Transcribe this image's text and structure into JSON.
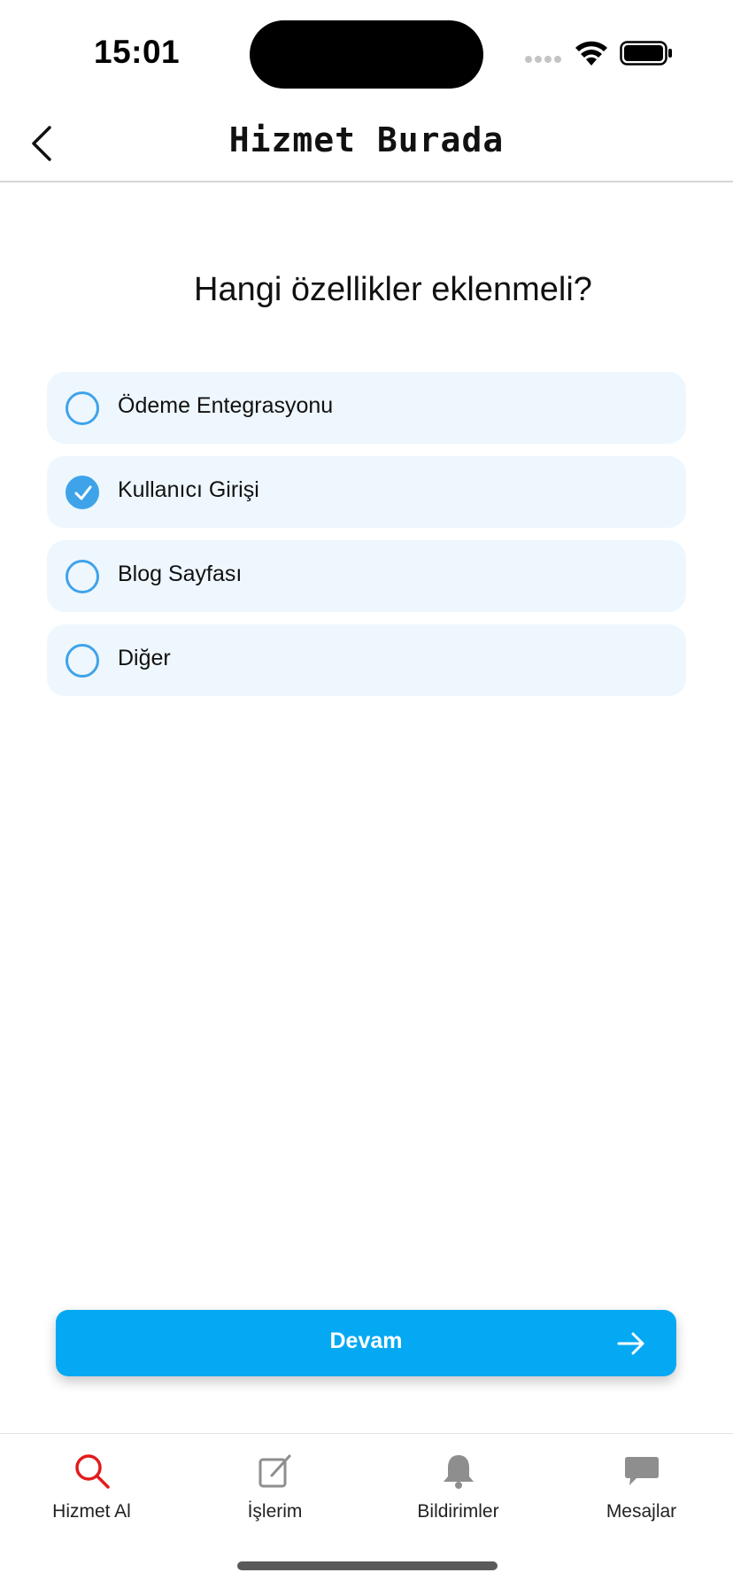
{
  "status_bar": {
    "time": "15:01"
  },
  "nav": {
    "title": "Hizmet Burada"
  },
  "question": {
    "title": "Hangi özellikler eklenmeli?"
  },
  "options": [
    {
      "label": "Ödeme Entegrasyonu",
      "checked": false
    },
    {
      "label": "Kullanıcı Girişi",
      "checked": true
    },
    {
      "label": "Blog Sayfası",
      "checked": false
    },
    {
      "label": "Diğer",
      "checked": false
    }
  ],
  "continue_button": {
    "label": "Devam"
  },
  "tabs": [
    {
      "label": "Hizmet Al",
      "icon": "search-icon",
      "active": true
    },
    {
      "label": "İşlerim",
      "icon": "edit-icon",
      "active": false
    },
    {
      "label": "Bildirimler",
      "icon": "bell-icon",
      "active": false
    },
    {
      "label": "Mesajlar",
      "icon": "chat-icon",
      "active": false
    }
  ],
  "colors": {
    "accent": "#05a9f3",
    "radio": "#3fa3ea",
    "option_bg": "#eef7fd",
    "active_tab": "#e21b1b",
    "inactive_tab": "#8e8e8e"
  }
}
